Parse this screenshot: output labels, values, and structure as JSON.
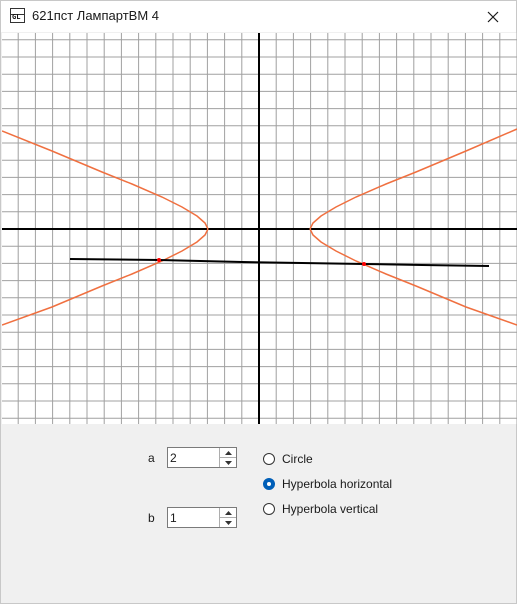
{
  "window": {
    "title": "621пст ЛампартВМ 4",
    "icon": "app-gl-icon",
    "close_icon": "close-icon"
  },
  "controls": {
    "a": {
      "label": "a",
      "value": "2"
    },
    "b": {
      "label": "b",
      "value": "1"
    },
    "shape_options": [
      {
        "label": "Circle",
        "checked": false
      },
      {
        "label": "Hyperbola horizontal",
        "checked": true
      },
      {
        "label": "Hyperbola vertical",
        "checked": false
      }
    ]
  },
  "colors": {
    "curve": "#f07040",
    "axes": "#000000",
    "grid": "#a0a0a0",
    "accent": "#005fb8",
    "marker": "#ff0000"
  }
}
